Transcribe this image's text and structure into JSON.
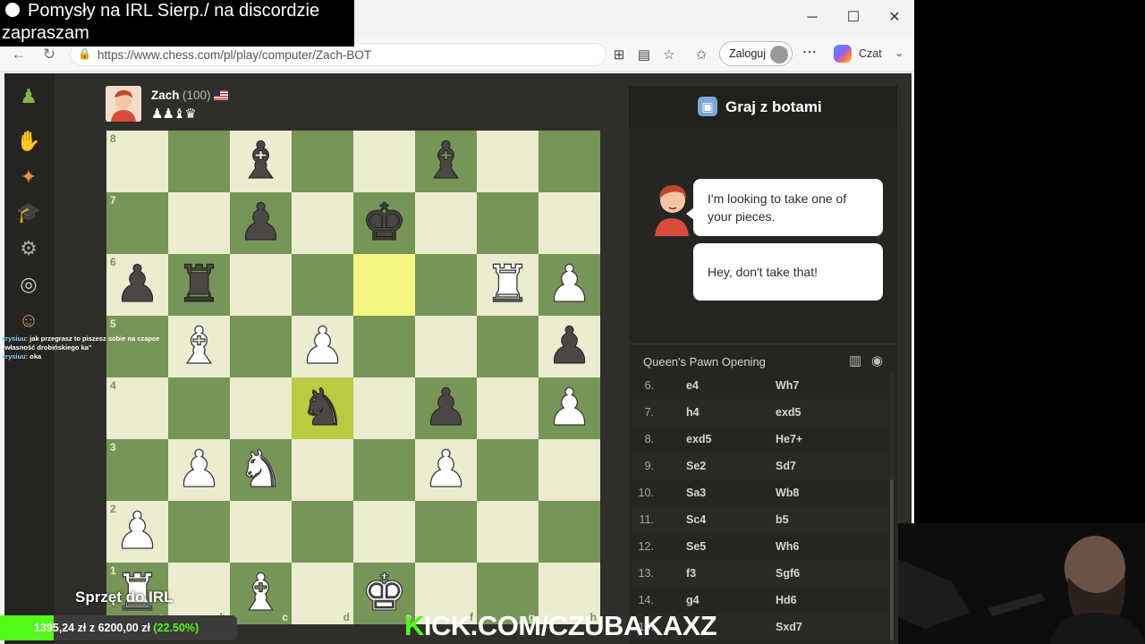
{
  "overlay": {
    "title": "Pomysły na IRL Sierp./ na discordzie zapraszam"
  },
  "browser": {
    "url": "https://www.chess.com/pl/play/computer/Zach-BOT",
    "login_label": "Zaloguj",
    "copilot_label": "Czat"
  },
  "player": {
    "name": "Zach",
    "rating": "(100)",
    "captured": "♟♟♝♛"
  },
  "board": {
    "ranks": [
      "8",
      "7",
      "6",
      "5",
      "4",
      "3",
      "2",
      "1"
    ],
    "files": [
      "a",
      "b",
      "c",
      "d",
      "e",
      "f",
      "g",
      "h"
    ],
    "pieces": [
      {
        "sq": "c8",
        "p": "b",
        "c": "b"
      },
      {
        "sq": "f8",
        "p": "b",
        "c": "b"
      },
      {
        "sq": "c7",
        "p": "p",
        "c": "b"
      },
      {
        "sq": "e7",
        "p": "k",
        "c": "b"
      },
      {
        "sq": "a6",
        "p": "p",
        "c": "b"
      },
      {
        "sq": "b6",
        "p": "r",
        "c": "b"
      },
      {
        "sq": "g6",
        "p": "r",
        "c": "w"
      },
      {
        "sq": "h6",
        "p": "p",
        "c": "w"
      },
      {
        "sq": "b5",
        "p": "b",
        "c": "w"
      },
      {
        "sq": "d5",
        "p": "p",
        "c": "w"
      },
      {
        "sq": "h5",
        "p": "p",
        "c": "b"
      },
      {
        "sq": "d4",
        "p": "n",
        "c": "b"
      },
      {
        "sq": "f4",
        "p": "p",
        "c": "b"
      },
      {
        "sq": "h4",
        "p": "p",
        "c": "w"
      },
      {
        "sq": "b3",
        "p": "p",
        "c": "w"
      },
      {
        "sq": "c3",
        "p": "n",
        "c": "w"
      },
      {
        "sq": "f3",
        "p": "p",
        "c": "w"
      },
      {
        "sq": "a2",
        "p": "p",
        "c": "w"
      },
      {
        "sq": "a1",
        "p": "r",
        "c": "w"
      },
      {
        "sq": "c1",
        "p": "b",
        "c": "w"
      },
      {
        "sq": "e1",
        "p": "k",
        "c": "w"
      }
    ],
    "highlights": [
      "e6",
      "d4"
    ]
  },
  "panel": {
    "title": "Graj z botami",
    "messages": [
      "I'm looking to take one of your pieces.",
      "Hey, don't take that!"
    ],
    "opening": "Queen's Pawn Opening",
    "moves": [
      {
        "n": "6.",
        "w": "e4",
        "b": "Wh7"
      },
      {
        "n": "7.",
        "w": "h4",
        "b": "exd5"
      },
      {
        "n": "8.",
        "w": "exd5",
        "b": "He7+"
      },
      {
        "n": "9.",
        "w": "Se2",
        "b": "Sd7"
      },
      {
        "n": "10.",
        "w": "Sa3",
        "b": "Wb8"
      },
      {
        "n": "11.",
        "w": "Sc4",
        "b": "b5"
      },
      {
        "n": "12.",
        "w": "Se5",
        "b": "Wh6"
      },
      {
        "n": "13.",
        "w": "f3",
        "b": "Sgf6"
      },
      {
        "n": "14.",
        "w": "g4",
        "b": "Hd6"
      },
      {
        "n": "15.",
        "w": "",
        "b": "Sxd7"
      }
    ]
  },
  "stream_chat": [
    {
      "user": "xrysiuu:",
      "text": "jak przegrasz to piszesz sobie na czapce \"własność drobińskiego ka\""
    },
    {
      "user": "xrysiuu:",
      "text": "oka"
    }
  ],
  "stream": {
    "irl_label": "Sprzęt do IRL",
    "donation_text": "1395,24 zł z 6200,00 zł",
    "donation_pct": "(22.50%)",
    "donation_fraction": 0.225,
    "kick_k": "K",
    "kick_rest": "ICK.COM/CZUBAKAXZ"
  },
  "colors": {
    "board_light": "#ebecd0",
    "board_dark": "#779556",
    "kick_green": "#53fc18"
  }
}
